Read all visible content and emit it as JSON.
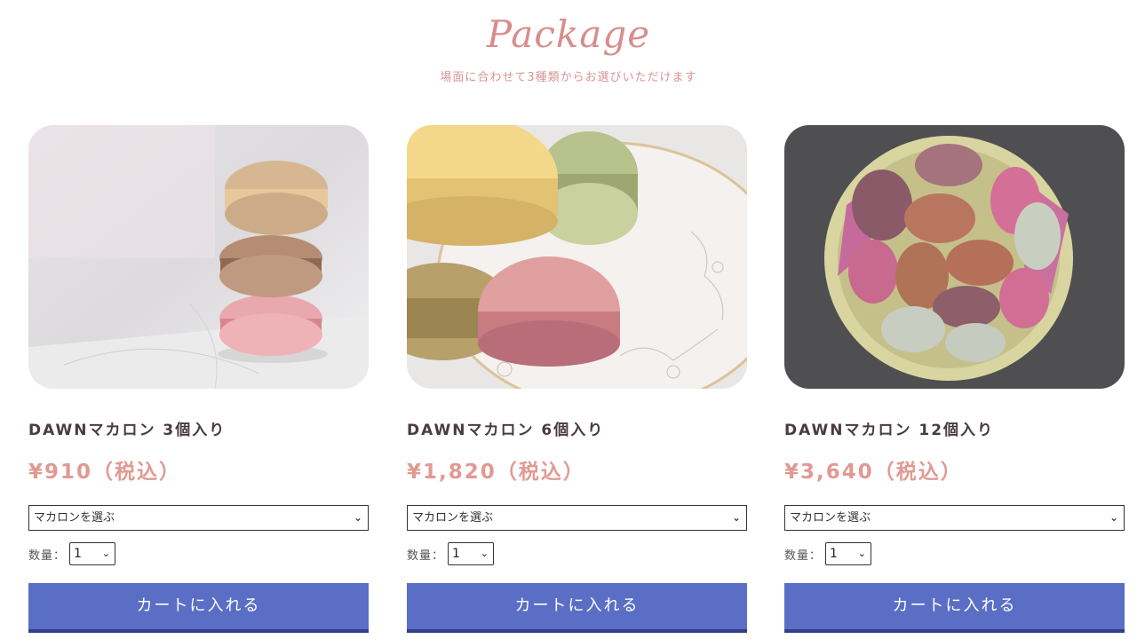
{
  "header": {
    "title": "Package",
    "subtitle": "場面に合わせて3種類からお選びいただけます"
  },
  "products": [
    {
      "name": "DAWNマカロン 3個入り",
      "price": "¥910（税込）",
      "flavor_select": "マカロンを選ぶ",
      "quantity_label": "数量：",
      "quantity_value": "1",
      "cart_button": "カートに入れる"
    },
    {
      "name": "DAWNマカロン 6個入り",
      "price": "¥1,820（税込）",
      "flavor_select": "マカロンを選ぶ",
      "quantity_label": "数量：",
      "quantity_value": "1",
      "cart_button": "カートに入れる"
    },
    {
      "name": "DAWNマカロン 12個入り",
      "price": "¥3,640（税込）",
      "flavor_select": "マカロンを選ぶ",
      "quantity_label": "数量：",
      "quantity_value": "1",
      "cart_button": "カートに入れる"
    }
  ],
  "colors": {
    "accent_pink": "#d98c8c",
    "price_pink": "#e09a93",
    "button_blue": "#5a6ec5"
  }
}
